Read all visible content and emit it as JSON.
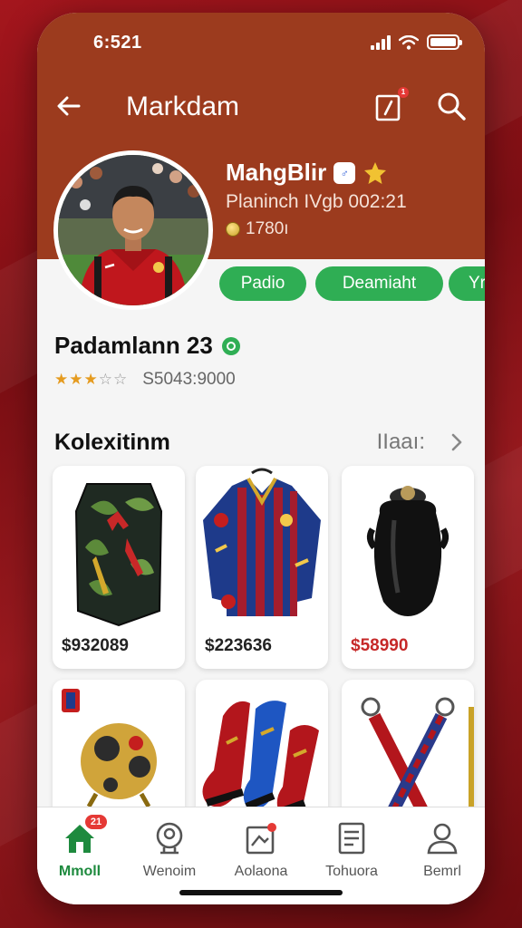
{
  "status": {
    "time": "6:521"
  },
  "header": {
    "back_icon": "arrow-left-icon",
    "title": "Markdam",
    "notification_count": "1"
  },
  "profile": {
    "name": "MahgBlir",
    "subtitle": "Planinch IVgb 002:21",
    "coins": "1780ı"
  },
  "pills": [
    "Padio",
    "Deamiaht",
    "Yr"
  ],
  "player": {
    "title": "Padamlann 23",
    "rating_stars": 3,
    "rating_max": 5,
    "price": "S5043:9000"
  },
  "collection": {
    "title": "Kolexitinm",
    "view_all": "IIaaı:",
    "items": [
      {
        "name": "shin-guard",
        "price": "$932089"
      },
      {
        "name": "jersey",
        "price": "$223636"
      },
      {
        "name": "black-vase",
        "price": "$58990"
      },
      {
        "name": "golden-ball",
        "price": ""
      },
      {
        "name": "football-boots",
        "price": ""
      },
      {
        "name": "lanyards",
        "price": ""
      }
    ]
  },
  "nav": [
    {
      "label": "Mmoll",
      "icon": "home-icon",
      "badge": "21",
      "active": true
    },
    {
      "label": "Wenoim",
      "icon": "profile-badge-icon",
      "active": false
    },
    {
      "label": "Aolaona",
      "icon": "collection-icon",
      "badge": "",
      "active": false
    },
    {
      "label": "Tohuora",
      "icon": "document-icon",
      "active": false
    },
    {
      "label": "Bemrl",
      "icon": "user-icon",
      "active": false
    }
  ],
  "colors": {
    "header": "#9c3b1e",
    "accent_green": "#2fae54",
    "price_red": "#c62828",
    "background": "#8e1419"
  }
}
